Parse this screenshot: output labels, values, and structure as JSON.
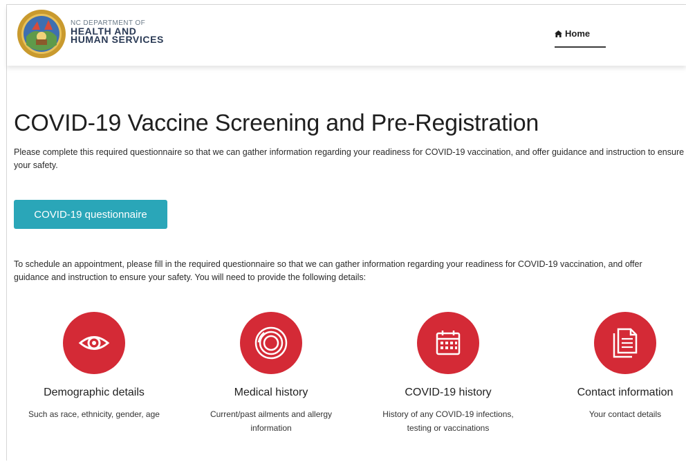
{
  "header": {
    "agency_line1": "NC DEPARTMENT OF",
    "agency_line2": "HEALTH AND",
    "agency_line3": "HUMAN SERVICES",
    "nav_home_icon": "home-icon",
    "nav_home_label": "Home"
  },
  "main": {
    "title": "COVID-19 Vaccine Screening and Pre-Registration",
    "intro": "Please complete this required questionnaire so that we can gather information regarding your readiness for COVID-19 vaccination, and offer guidance and instruction to ensure your safety.",
    "cta_label": "COVID-19 questionnaire",
    "schedule_text": "To schedule an appointment, please fill in the required questionnaire so that we can gather information regarding your readiness for COVID-19 vaccination, and offer guidance and instruction to ensure your safety. You will need to provide the following details:"
  },
  "features": [
    {
      "icon": "eye-icon",
      "title": "Demographic details",
      "description": "Such as race, ethnicity, gender, age"
    },
    {
      "icon": "medical-history-icon",
      "title": "Medical history",
      "description": "Current/past ailments and allergy information"
    },
    {
      "icon": "calendar-icon",
      "title": "COVID-19 history",
      "description": "History of any COVID-19 infections, testing or vaccinations"
    },
    {
      "icon": "document-icon",
      "title": "Contact information",
      "description": "Your contact details"
    }
  ],
  "colors": {
    "accent_teal": "#2aa6b8",
    "icon_red": "#d42a36",
    "logo_navy": "#2a3a55"
  }
}
